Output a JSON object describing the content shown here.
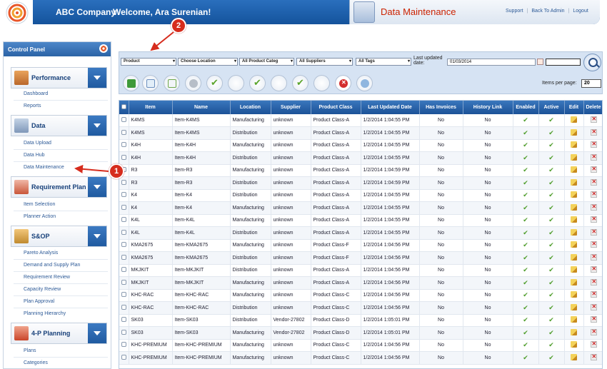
{
  "header": {
    "company": "ABC Company",
    "welcome": "Welcome, Ara Surenian!",
    "page_title": "Data Maintenance",
    "links": [
      "Support",
      "Back To Admin",
      "Logout"
    ]
  },
  "sidebar": {
    "title": "Control Panel",
    "sections": [
      {
        "label": "Performance",
        "items": [
          "Dashboard",
          "Reports"
        ]
      },
      {
        "label": "Data",
        "items": [
          "Data Upload",
          "Data Hub",
          "Data Maintenance"
        ]
      },
      {
        "label": "Requirement Plan",
        "items": [
          "Item Selection",
          "Planner Action"
        ]
      },
      {
        "label": "S&OP",
        "items": [
          "Pareto Analysis",
          "Demand and Supply Plan",
          "Requirement Review",
          "Capacity Review",
          "Plan Approval",
          "Planning Hierarchy"
        ]
      },
      {
        "label": "4-P Planning",
        "items": [
          "Plans",
          "Categories"
        ]
      }
    ]
  },
  "filters": {
    "product": "Product",
    "location": "Choose Location",
    "category": "All Product Categ",
    "suppliers": "All Suppliers",
    "tags": "All Tags",
    "last_updated_label": "Last updated date:",
    "date_value": "01/03/2014",
    "items_per_page_label": "Items per page:",
    "items_per_page": "20"
  },
  "table": {
    "columns": [
      "Item",
      "Name",
      "Location",
      "Supplier",
      "Product Class",
      "Last Updated Date",
      "Has Invoices",
      "History Link",
      "Enabled",
      "Active",
      "Edit",
      "Delete"
    ],
    "rows": [
      [
        "K4MS",
        "Item-K4MS",
        "Manufacturing",
        "unknown",
        "Product Class-A",
        "1/2/2014 1:04:55 PM",
        "No",
        "No"
      ],
      [
        "K4MS",
        "Item-K4MS",
        "Distribution",
        "unknown",
        "Product Class-A",
        "1/2/2014 1:04:55 PM",
        "No",
        "No"
      ],
      [
        "K4H",
        "Item-K4H",
        "Manufacturing",
        "unknown",
        "Product Class-A",
        "1/2/2014 1:04:55 PM",
        "No",
        "No"
      ],
      [
        "K4H",
        "Item-K4H",
        "Distribution",
        "unknown",
        "Product Class-A",
        "1/2/2014 1:04:55 PM",
        "No",
        "No"
      ],
      [
        "R3",
        "Item-R3",
        "Manufacturing",
        "unknown",
        "Product Class-A",
        "1/2/2014 1:04:59 PM",
        "No",
        "No"
      ],
      [
        "R3",
        "Item-R3",
        "Distribution",
        "unknown",
        "Product Class-A",
        "1/2/2014 1:04:59 PM",
        "No",
        "No"
      ],
      [
        "K4",
        "Item-K4",
        "Distribution",
        "unknown",
        "Product Class-A",
        "1/2/2014 1:04:55 PM",
        "No",
        "No"
      ],
      [
        "K4",
        "Item-K4",
        "Manufacturing",
        "unknown",
        "Product Class-A",
        "1/2/2014 1:04:55 PM",
        "No",
        "No"
      ],
      [
        "K4L",
        "Item-K4L",
        "Manufacturing",
        "unknown",
        "Product Class-A",
        "1/2/2014 1:04:55 PM",
        "No",
        "No"
      ],
      [
        "K4L",
        "Item-K4L",
        "Distribution",
        "unknown",
        "Product Class-A",
        "1/2/2014 1:04:55 PM",
        "No",
        "No"
      ],
      [
        "KMA2675",
        "Item-KMA2675",
        "Manufacturing",
        "unknown",
        "Product Class-F",
        "1/2/2014 1:04:56 PM",
        "No",
        "No"
      ],
      [
        "KMA2675",
        "Item-KMA2675",
        "Distribution",
        "unknown",
        "Product Class-F",
        "1/2/2014 1:04:56 PM",
        "No",
        "No"
      ],
      [
        "MKJKIT",
        "Item-MKJKIT",
        "Distribution",
        "unknown",
        "Product Class-A",
        "1/2/2014 1:04:56 PM",
        "No",
        "No"
      ],
      [
        "MKJKIT",
        "Item-MKJKIT",
        "Manufacturing",
        "unknown",
        "Product Class-A",
        "1/2/2014 1:04:56 PM",
        "No",
        "No"
      ],
      [
        "KHC-RAC",
        "Item-KHC-RAC",
        "Manufacturing",
        "unknown",
        "Product Class-C",
        "1/2/2014 1:04:56 PM",
        "No",
        "No"
      ],
      [
        "KHC-RAC",
        "Item-KHC-RAC",
        "Distribution",
        "unknown",
        "Product Class-C",
        "1/2/2014 1:04:56 PM",
        "No",
        "No"
      ],
      [
        "SK03",
        "Item-SK03",
        "Distribution",
        "Vendor-27802",
        "Product Class-D",
        "1/2/2014 1:05:01 PM",
        "No",
        "No"
      ],
      [
        "SK03",
        "Item-SK03",
        "Manufacturing",
        "Vendor-27802",
        "Product Class-D",
        "1/2/2014 1:05:01 PM",
        "No",
        "No"
      ],
      [
        "KHC-PREMIUM",
        "Item-KHC-PREMIUM",
        "Manufacturing",
        "unknown",
        "Product Class-C",
        "1/2/2014 1:04:56 PM",
        "No",
        "No"
      ],
      [
        "KHC-PREMIUM",
        "Item-KHC-PREMIUM",
        "Manufacturing",
        "unknown",
        "Product Class-C",
        "1/2/2014 1:04:56 PM",
        "No",
        "No"
      ]
    ]
  },
  "callouts": {
    "one": "1",
    "two": "2"
  },
  "colors": {
    "header_blue": "#1f5fa8",
    "title_red": "#cc2200",
    "callout": "#d62c1d",
    "check_green": "#4f9d2b"
  }
}
